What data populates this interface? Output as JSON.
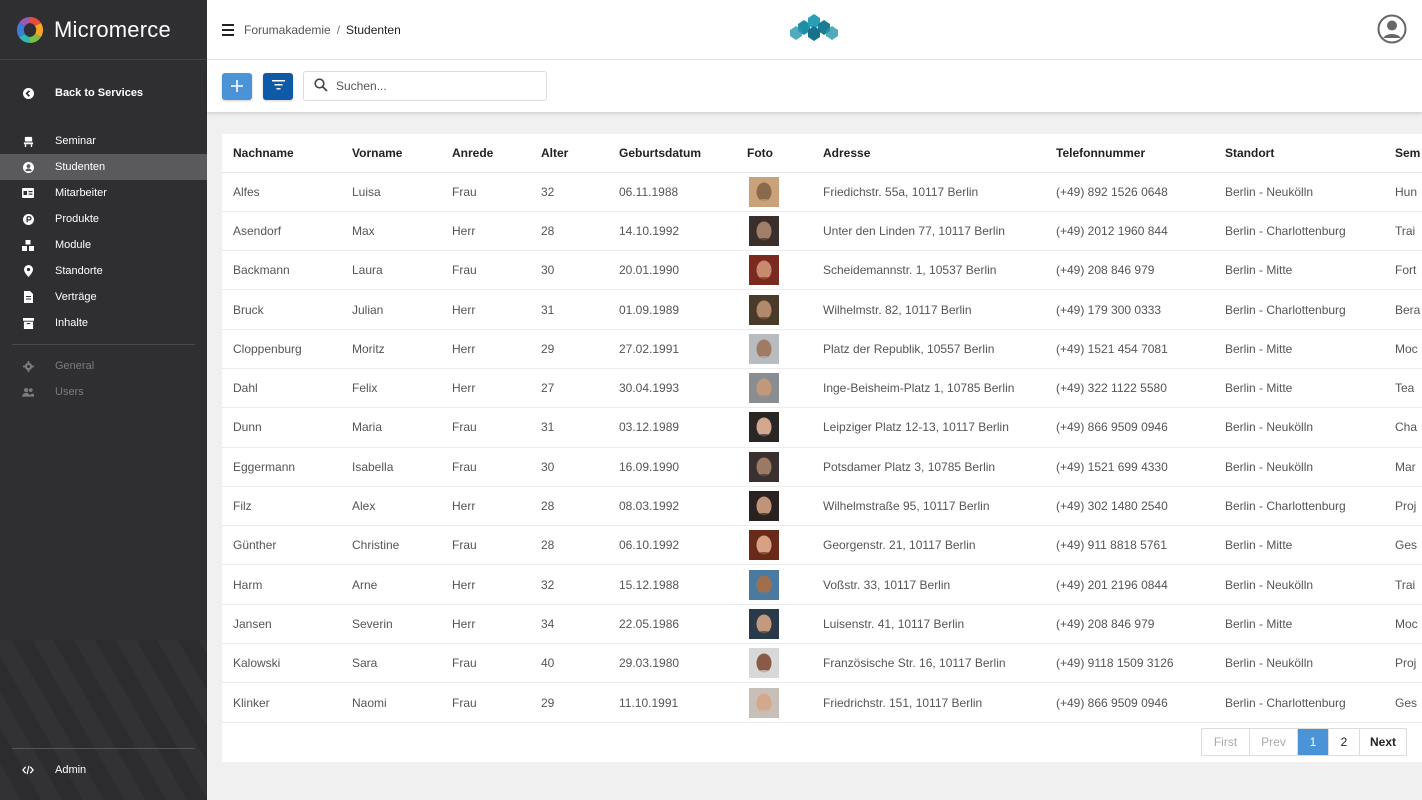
{
  "sidebar": {
    "brand": "Micromerce",
    "back": "Back to Services",
    "items": [
      {
        "label": "Seminar",
        "icon": "seminar-icon"
      },
      {
        "label": "Studenten",
        "icon": "student-icon"
      },
      {
        "label": "Mitarbeiter",
        "icon": "id-card-icon"
      },
      {
        "label": "Produkte",
        "icon": "product-icon"
      },
      {
        "label": "Module",
        "icon": "modules-icon"
      },
      {
        "label": "Standorte",
        "icon": "location-pin-icon"
      },
      {
        "label": "Verträge",
        "icon": "contract-icon"
      },
      {
        "label": "Inhalte",
        "icon": "archive-icon"
      }
    ],
    "secondary": [
      {
        "label": "General",
        "icon": "gear-icon"
      },
      {
        "label": "Users",
        "icon": "users-icon"
      }
    ],
    "admin": "Admin",
    "active": "Studenten"
  },
  "header": {
    "breadcrumb": [
      "Forumakademie",
      "Studenten"
    ]
  },
  "toolbar": {
    "search_placeholder": "Suchen..."
  },
  "table": {
    "columns": [
      "Nachname",
      "Vorname",
      "Anrede",
      "Alter",
      "Geburtsdatum",
      "Foto",
      "Adresse",
      "Telefonnummer",
      "Standort",
      "Sem"
    ],
    "rows": [
      [
        "Alfes",
        "Luisa",
        "Frau",
        "32",
        "06.11.1988",
        "",
        "Friedichstr. 55a, 10117 Berlin",
        "(+49) 892 1526 0648",
        "Berlin - Neukölln",
        "Hun"
      ],
      [
        "Asendorf",
        "Max",
        "Herr",
        "28",
        "14.10.1992",
        "",
        "Unter den Linden 77, 10117 Berlin",
        "(+49) 2012 1960 844",
        "Berlin - Charlottenburg",
        "Trai"
      ],
      [
        "Backmann",
        "Laura",
        "Frau",
        "30",
        "20.01.1990",
        "",
        "Scheidemannstr. 1, 10537 Berlin",
        "(+49) 208 846 979",
        "Berlin - Mitte",
        "Fort"
      ],
      [
        "Bruck",
        "Julian",
        "Herr",
        "31",
        "01.09.1989",
        "",
        "Wilhelmstr. 82, 10117 Berlin",
        "(+49) 179 300 0333",
        "Berlin - Charlottenburg",
        "Bera"
      ],
      [
        "Cloppenburg",
        "Moritz",
        "Herr",
        "29",
        "27.02.1991",
        "",
        "Platz der Republik, 10557 Berlin",
        "(+49) 1521 454 7081",
        "Berlin - Mitte",
        "Moc"
      ],
      [
        "Dahl",
        "Felix",
        "Herr",
        "27",
        "30.04.1993",
        "",
        "Inge-Beisheim-Platz 1, 10785 Berlin",
        "(+49) 322 1122 5580",
        "Berlin - Mitte",
        "Tea"
      ],
      [
        "Dunn",
        "Maria",
        "Frau",
        "31",
        "03.12.1989",
        "",
        "Leipziger Platz 12-13, 10117 Berlin",
        "(+49) 866 9509 0946",
        "Berlin - Neukölln",
        "Cha"
      ],
      [
        "Eggermann",
        "Isabella",
        "Frau",
        "30",
        "16.09.1990",
        "",
        "Potsdamer Platz 3, 10785 Berlin",
        "(+49) 1521 699 4330",
        "Berlin - Neukölln",
        "Mar"
      ],
      [
        "Filz",
        "Alex",
        "Herr",
        "28",
        "08.03.1992",
        "",
        "Wilhelmstraße 95, 10117 Berlin",
        "(+49) 302 1480 2540",
        "Berlin - Charlottenburg",
        "Proj"
      ],
      [
        "Günther",
        "Christine",
        "Frau",
        "28",
        "06.10.1992",
        "",
        "Georgenstr. 21, 10117 Berlin",
        "(+49) 911 8818 5761",
        "Berlin - Mitte",
        "Ges"
      ],
      [
        "Harm",
        "Arne",
        "Herr",
        "32",
        "15.12.1988",
        "",
        "Voßstr. 33, 10117 Berlin",
        "(+49) 201 2196 0844",
        "Berlin - Neukölln",
        "Trai"
      ],
      [
        "Jansen",
        "Severin",
        "Herr",
        "34",
        "22.05.1986",
        "",
        "Luisenstr. 41, 10117 Berlin",
        "(+49) 208 846 979",
        "Berlin - Mitte",
        "Moc"
      ],
      [
        "Kalowski",
        "Sara",
        "Frau",
        "40",
        "29.03.1980",
        "",
        "Französische Str. 16, 10117 Berlin",
        "(+49) 9118 1509 3126",
        "Berlin - Neukölln",
        "Proj"
      ],
      [
        "Klinker",
        "Naomi",
        "Frau",
        "29",
        "11.10.1991",
        "",
        "Friedrichstr. 151, 10117 Berlin",
        "(+49) 866 9509 0946",
        "Berlin - Charlottenburg",
        "Ges"
      ]
    ],
    "photo_colors": [
      [
        "#c9a27a",
        "#8a6a4a"
      ],
      [
        "#3a2f2a",
        "#a0806a"
      ],
      [
        "#7a2a1f",
        "#c78a6f"
      ],
      [
        "#4a3a2a",
        "#b08a6a"
      ],
      [
        "#b8bcc0",
        "#a07a62"
      ],
      [
        "#8a8e92",
        "#c2987a"
      ],
      [
        "#2a2626",
        "#d2a88e"
      ],
      [
        "#3a3030",
        "#9a7a66"
      ],
      [
        "#2a2220",
        "#c09478"
      ],
      [
        "#6a2a1a",
        "#d8a084"
      ],
      [
        "#4a7aa0",
        "#a0704e"
      ],
      [
        "#2a3a4a",
        "#c49a7e"
      ],
      [
        "#d8d8d8",
        "#8a5a46"
      ],
      [
        "#c8c0b8",
        "#d4a88c"
      ]
    ]
  },
  "pagination": {
    "first": "First",
    "prev": "Prev",
    "pages": [
      "1",
      "2"
    ],
    "current": "1",
    "next": "Next"
  },
  "colors": {
    "sidebar_bg": "#2f2f31",
    "accent": "#4a93d6",
    "filter_button": "#0e5aa7"
  }
}
